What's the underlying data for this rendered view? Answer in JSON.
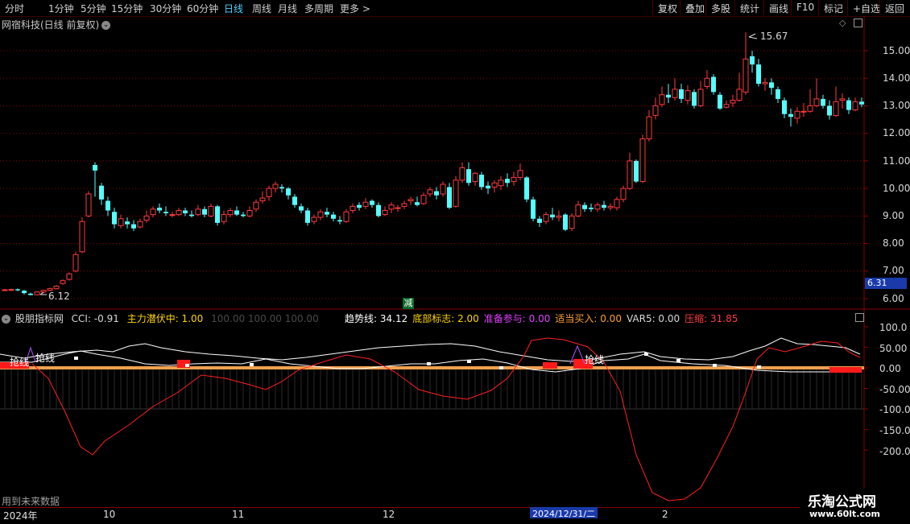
{
  "toolbar": {
    "periods": [
      "分时",
      "1分钟",
      "5分钟",
      "15分钟",
      "30分钟",
      "60分钟",
      "日线",
      "周线",
      "月线",
      "多周期",
      "更多 >"
    ],
    "active_period": "日线",
    "right_buttons": [
      "复权",
      "叠加",
      "多股",
      "统计",
      "画线",
      "F10",
      "标记",
      "+自选",
      "返回"
    ]
  },
  "stock": {
    "title": "网宿科技(日线 前复权)",
    "high_label": "15.67",
    "low_label": "6.12",
    "current_price": "6.31",
    "signal_mark": "减"
  },
  "price_axis": [
    "15.00",
    "14.00",
    "13.00",
    "12.00",
    "11.00",
    "10.00",
    "9.00",
    "8.00",
    "7.00",
    "6.00"
  ],
  "indicator": {
    "name": "股朋指标网",
    "cci": "CCI: -0.91",
    "zhuli": "主力潜伏中: 1.00",
    "ghost": "100.00    100.00    100.00",
    "trend": "趋势线: 34.12",
    "bottom": "底部标志: 2.00",
    "prepare": "准备参与: 0.00",
    "buy": "适当买入: 0.00",
    "var5": "VAR5: 0.00",
    "squeeze": "压缩: 31.85",
    "axis": [
      "100.0",
      "50.00",
      "0.00",
      "-50.00",
      "-100.0",
      "-150.0",
      "-200.0"
    ],
    "label_qiang": "抢线",
    "footer": "用到未来数据"
  },
  "dates": {
    "year": "2024年",
    "months": [
      "10",
      "11",
      "12",
      "2"
    ],
    "cursor": "2024/12/31/二"
  },
  "watermark": {
    "line1": "乐淘公式网",
    "line2": "www.60lt.com"
  },
  "colors": {
    "up": "#ff3b3b",
    "down": "#54ffff",
    "bg": "#000000",
    "grid": "#8a0000"
  },
  "chart_data": {
    "type": "candlestick",
    "ylim": [
      6.0,
      15.67
    ],
    "candles": [
      [
        6.3,
        6.32,
        6.35,
        6.28
      ],
      [
        6.31,
        6.33,
        6.36,
        6.29
      ],
      [
        6.34,
        6.3,
        6.37,
        6.27
      ],
      [
        6.29,
        6.2,
        6.31,
        6.15
      ],
      [
        6.18,
        6.13,
        6.22,
        6.12
      ],
      [
        6.14,
        6.24,
        6.27,
        6.12
      ],
      [
        6.24,
        6.3,
        6.33,
        6.2
      ],
      [
        6.3,
        6.36,
        6.4,
        6.27
      ],
      [
        6.36,
        6.45,
        6.5,
        6.33
      ],
      [
        6.55,
        6.65,
        6.7,
        6.5
      ],
      [
        6.7,
        6.9,
        6.95,
        6.65
      ],
      [
        7.0,
        7.6,
        7.7,
        6.95
      ],
      [
        7.7,
        8.8,
        8.95,
        7.65
      ],
      [
        9.0,
        9.8,
        9.9,
        8.95
      ],
      [
        10.85,
        10.65,
        10.95,
        9.7
      ],
      [
        10.1,
        9.6,
        10.2,
        9.4
      ],
      [
        9.55,
        9.2,
        9.7,
        9.0
      ],
      [
        9.15,
        8.7,
        9.3,
        8.55
      ],
      [
        8.65,
        8.9,
        9.05,
        8.55
      ],
      [
        8.8,
        8.7,
        8.95,
        8.55
      ],
      [
        8.7,
        8.55,
        8.85,
        8.45
      ],
      [
        8.6,
        8.8,
        8.9,
        8.55
      ],
      [
        8.85,
        9.0,
        9.2,
        8.75
      ],
      [
        9.05,
        9.25,
        9.35,
        8.95
      ],
      [
        9.3,
        9.2,
        9.45,
        9.1
      ],
      [
        9.15,
        9.1,
        9.35,
        9.0
      ],
      [
        9.05,
        9.05,
        9.15,
        8.95
      ],
      [
        9.05,
        9.2,
        9.3,
        9.0
      ],
      [
        9.2,
        9.1,
        9.3,
        9.0
      ],
      [
        9.05,
        9.0,
        9.2,
        8.95
      ],
      [
        9.05,
        9.25,
        9.4,
        9.0
      ],
      [
        9.25,
        9.05,
        9.35,
        8.95
      ],
      [
        9.0,
        9.35,
        9.45,
        8.95
      ],
      [
        9.35,
        8.75,
        9.4,
        8.65
      ],
      [
        8.8,
        9.05,
        9.2,
        8.7
      ],
      [
        9.05,
        9.2,
        9.3,
        8.95
      ],
      [
        9.2,
        9.05,
        9.35,
        9.0
      ],
      [
        9.05,
        9.0,
        9.15,
        8.95
      ],
      [
        9.0,
        9.2,
        9.35,
        8.95
      ],
      [
        9.25,
        9.5,
        9.6,
        9.15
      ],
      [
        9.55,
        9.65,
        9.9,
        9.45
      ],
      [
        9.7,
        10.0,
        10.1,
        9.55
      ],
      [
        10.0,
        10.15,
        10.25,
        9.85
      ],
      [
        10.05,
        10.0,
        10.15,
        9.85
      ],
      [
        10.0,
        9.75,
        10.05,
        9.6
      ],
      [
        9.7,
        9.4,
        9.8,
        9.3
      ],
      [
        9.35,
        9.2,
        9.45,
        9.1
      ],
      [
        9.2,
        8.75,
        9.3,
        8.65
      ],
      [
        8.8,
        8.95,
        9.05,
        8.7
      ],
      [
        8.95,
        9.15,
        9.25,
        8.85
      ],
      [
        9.15,
        9.05,
        9.3,
        8.95
      ],
      [
        9.05,
        8.9,
        9.15,
        8.8
      ],
      [
        8.85,
        8.8,
        9.0,
        8.7
      ],
      [
        8.8,
        9.15,
        9.25,
        8.75
      ],
      [
        9.2,
        9.35,
        9.45,
        9.1
      ],
      [
        9.4,
        9.3,
        9.5,
        9.2
      ],
      [
        9.35,
        9.5,
        9.65,
        9.25
      ],
      [
        9.55,
        9.4,
        9.6,
        9.3
      ],
      [
        9.4,
        9.0,
        9.5,
        8.95
      ],
      [
        9.05,
        9.2,
        9.35,
        9.0
      ],
      [
        9.25,
        9.4,
        9.5,
        9.1
      ],
      [
        9.3,
        9.3,
        9.4,
        9.15
      ],
      [
        9.35,
        9.45,
        9.55,
        9.25
      ],
      [
        9.55,
        9.6,
        9.7,
        9.4
      ],
      [
        9.5,
        9.4,
        9.7,
        9.35
      ],
      [
        9.45,
        9.75,
        9.85,
        9.4
      ],
      [
        9.8,
        9.95,
        10.05,
        9.7
      ],
      [
        9.9,
        9.75,
        10.05,
        9.6
      ],
      [
        9.8,
        10.15,
        10.25,
        9.7
      ],
      [
        10.05,
        9.3,
        10.2,
        9.25
      ],
      [
        9.35,
        10.3,
        10.45,
        9.3
      ],
      [
        10.3,
        10.75,
        10.95,
        10.2
      ],
      [
        10.7,
        10.2,
        10.95,
        10.1
      ],
      [
        10.25,
        10.55,
        10.6,
        10.1
      ],
      [
        10.5,
        10.05,
        10.6,
        9.95
      ],
      [
        10.1,
        10.0,
        10.25,
        9.8
      ],
      [
        10.05,
        10.2,
        10.3,
        9.85
      ],
      [
        10.1,
        10.3,
        10.45,
        9.95
      ],
      [
        10.35,
        10.2,
        10.55,
        10.05
      ],
      [
        10.25,
        10.4,
        10.6,
        10.1
      ],
      [
        10.4,
        10.65,
        10.9,
        10.3
      ],
      [
        10.4,
        9.6,
        10.45,
        9.5
      ],
      [
        9.6,
        8.9,
        9.7,
        8.8
      ],
      [
        8.9,
        8.75,
        9.0,
        8.6
      ],
      [
        8.8,
        9.05,
        9.15,
        8.7
      ],
      [
        9.05,
        8.95,
        9.3,
        8.85
      ],
      [
        8.95,
        9.0,
        9.2,
        8.8
      ],
      [
        9.05,
        8.5,
        9.1,
        8.45
      ],
      [
        8.55,
        9.0,
        9.1,
        8.45
      ],
      [
        9.0,
        9.4,
        9.55,
        8.95
      ],
      [
        9.4,
        9.25,
        9.5,
        9.15
      ],
      [
        9.3,
        9.25,
        9.45,
        9.15
      ],
      [
        9.25,
        9.4,
        9.5,
        9.15
      ],
      [
        9.4,
        9.3,
        9.55,
        9.2
      ],
      [
        9.3,
        9.35,
        9.45,
        9.2
      ],
      [
        9.3,
        9.6,
        9.7,
        9.2
      ],
      [
        9.6,
        10.0,
        10.1,
        9.5
      ],
      [
        10.0,
        11.0,
        11.3,
        9.95
      ],
      [
        11.0,
        10.25,
        11.05,
        10.2
      ],
      [
        10.25,
        11.8,
        11.95,
        10.2
      ],
      [
        11.8,
        12.6,
        12.85,
        11.7
      ],
      [
        12.65,
        13.0,
        13.3,
        12.5
      ],
      [
        13.05,
        13.4,
        13.7,
        12.95
      ],
      [
        13.4,
        13.3,
        13.8,
        13.1
      ],
      [
        13.3,
        13.6,
        14.0,
        13.2
      ],
      [
        13.6,
        13.25,
        13.8,
        13.1
      ],
      [
        13.2,
        13.55,
        13.75,
        13.05
      ],
      [
        13.5,
        13.0,
        13.6,
        12.9
      ],
      [
        13.0,
        13.6,
        13.9,
        12.95
      ],
      [
        13.7,
        14.0,
        14.3,
        13.6
      ],
      [
        14.05,
        13.5,
        14.15,
        13.4
      ],
      [
        13.4,
        12.9,
        13.5,
        12.85
      ],
      [
        12.95,
        13.05,
        13.2,
        12.9
      ],
      [
        13.1,
        13.2,
        13.4,
        12.95
      ],
      [
        13.2,
        13.6,
        14.2,
        13.15
      ],
      [
        13.5,
        14.7,
        15.67,
        13.4
      ],
      [
        14.8,
        14.5,
        15.0,
        14.2
      ],
      [
        14.5,
        13.8,
        14.7,
        13.7
      ],
      [
        13.8,
        13.85,
        14.0,
        13.55
      ],
      [
        13.85,
        13.65,
        14.0,
        13.4
      ],
      [
        13.6,
        13.25,
        13.7,
        13.1
      ],
      [
        13.2,
        12.7,
        13.3,
        12.55
      ],
      [
        12.7,
        12.6,
        12.9,
        12.25
      ],
      [
        12.55,
        12.8,
        12.95,
        12.35
      ],
      [
        12.8,
        12.8,
        13.1,
        12.6
      ],
      [
        12.8,
        13.0,
        13.6,
        12.75
      ],
      [
        13.0,
        13.25,
        14.0,
        12.95
      ],
      [
        13.25,
        13.0,
        13.4,
        12.9
      ],
      [
        13.0,
        12.65,
        13.2,
        12.5
      ],
      [
        12.65,
        13.15,
        13.7,
        12.6
      ],
      [
        13.2,
        13.25,
        13.45,
        12.9
      ],
      [
        13.2,
        12.85,
        13.3,
        12.7
      ],
      [
        12.85,
        13.15,
        13.3,
        12.8
      ],
      [
        13.15,
        13.05,
        13.3,
        12.95
      ]
    ]
  }
}
